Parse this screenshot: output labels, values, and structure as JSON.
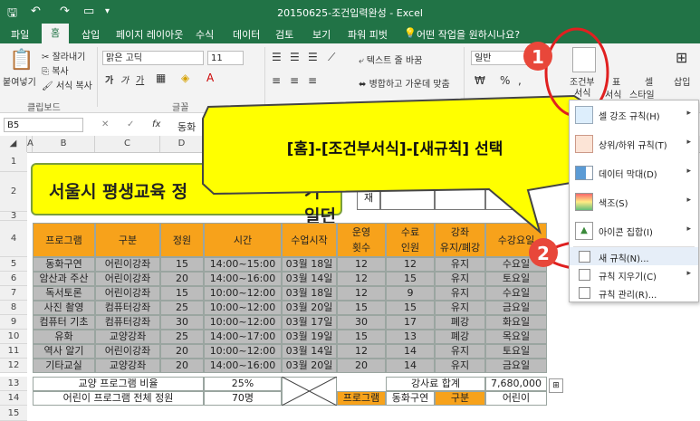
{
  "titlebar": {
    "title": "20150625-조건입력완성 - Excel"
  },
  "menu": {
    "tabs": [
      "파일",
      "홈",
      "삽입",
      "페이지 레이아웃",
      "수식",
      "데이터",
      "검토",
      "보기",
      "파워 피벗"
    ],
    "tellme": "어떤 작업을 원하시나요?"
  },
  "ribbon": {
    "paste": "붙여넣기",
    "cut": "잘라내기",
    "copy": "복사",
    "format_painter": "서식 복사",
    "clipboard": "클립보드",
    "font_name": "맑은 고딕",
    "font_size": "11",
    "font_group": "글꼴",
    "bold": "가",
    "italic": "가",
    "underline": "가",
    "wrap_text": "텍스트 줄 바꿈",
    "merge": "병합하고 가운데 맞춤",
    "number_format": "일반",
    "percent": "%",
    "comma": ",",
    "cond_format": "조건부",
    "cond_format2": "서식",
    "table": "표",
    "table2": "서식",
    "cell_style": "셀",
    "cell_style2": "스타일",
    "insert": "삽입",
    "style_group_partial": "스타일"
  },
  "formula_bar": {
    "name_box": "B5",
    "fx": "fx",
    "content": "동화"
  },
  "columns": [
    "A",
    "B",
    "C",
    "D"
  ],
  "rows": [
    "1",
    "2",
    "3",
    "4",
    "5",
    "6",
    "7",
    "8",
    "9",
    "10",
    "11",
    "12",
    "13",
    "14",
    "15"
  ],
  "sheet": {
    "title": "서울시 평생교육 정",
    "title_tail": "기 일던",
    "r2_side": "재",
    "headers": [
      "프로그램",
      "구분",
      "정원",
      "시간",
      "수업시작",
      "운영\n횟수",
      "수료\n인원",
      "강좌\n유지/폐강",
      "수강요일"
    ],
    "data": [
      [
        "동화구연",
        "어린이강좌",
        "15",
        "14:00~15:00",
        "03월 18일",
        "12",
        "12",
        "유지",
        "수요일"
      ],
      [
        "암산과 주산",
        "어린이강좌",
        "20",
        "14:00~16:00",
        "03월 14일",
        "12",
        "15",
        "유지",
        "토요일"
      ],
      [
        "독서토론",
        "어린이강좌",
        "15",
        "10:00~12:00",
        "03월 18일",
        "12",
        "9",
        "유지",
        "수요일"
      ],
      [
        "사진 촬영",
        "컴퓨터강좌",
        "25",
        "10:00~12:00",
        "03월 20일",
        "15",
        "15",
        "유지",
        "금요일"
      ],
      [
        "컴퓨터 기초",
        "컴퓨터강좌",
        "30",
        "10:00~12:00",
        "03월 17일",
        "30",
        "17",
        "폐강",
        "화요일"
      ],
      [
        "유화",
        "교양강좌",
        "25",
        "14:00~17:00",
        "03월 19일",
        "15",
        "13",
        "폐강",
        "목요일"
      ],
      [
        "역사 알기",
        "어린이강좌",
        "20",
        "10:00~12:00",
        "03월 14일",
        "12",
        "14",
        "유지",
        "토요일"
      ],
      [
        "기타교실",
        "교양강좌",
        "20",
        "14:00~16:00",
        "03월 20일",
        "20",
        "14",
        "유지",
        "금요일"
      ]
    ],
    "r13": {
      "label": "교양 프로그램 비율",
      "value": "25%",
      "fee_label": "강사료 합계",
      "fee_value": "7,680,000"
    },
    "r14": {
      "label": "어린이 프로그램 전체 정원",
      "value": "70명",
      "k1": "프로그램",
      "k2": "동화구연",
      "k3": "구분",
      "k4": "어린이"
    }
  },
  "callout": {
    "text": "[홈]-[조건부서식]-[새규칙]  선택"
  },
  "badges": {
    "one": "1",
    "two": "2"
  },
  "dropdown": {
    "items": [
      {
        "label": "셀 강조 규칙(H)",
        "has_arrow": true
      },
      {
        "label": "상위/하위 규칙(T)",
        "has_arrow": true
      },
      {
        "label": "데이터 막대(D)",
        "has_arrow": true
      },
      {
        "label": "색조(S)",
        "has_arrow": true
      },
      {
        "label": "아이콘 집합(I)",
        "has_arrow": true
      }
    ],
    "new_rule": "새 규칙(N)...",
    "clear_rules": "규칙 지우기(C)",
    "manage_rules": "규칙 관리(R)..."
  },
  "colors": {
    "excel_green": "#217346",
    "header_orange": "#f7a21b",
    "callout_yellow": "#ffff00",
    "badge_red": "#e8473a"
  }
}
